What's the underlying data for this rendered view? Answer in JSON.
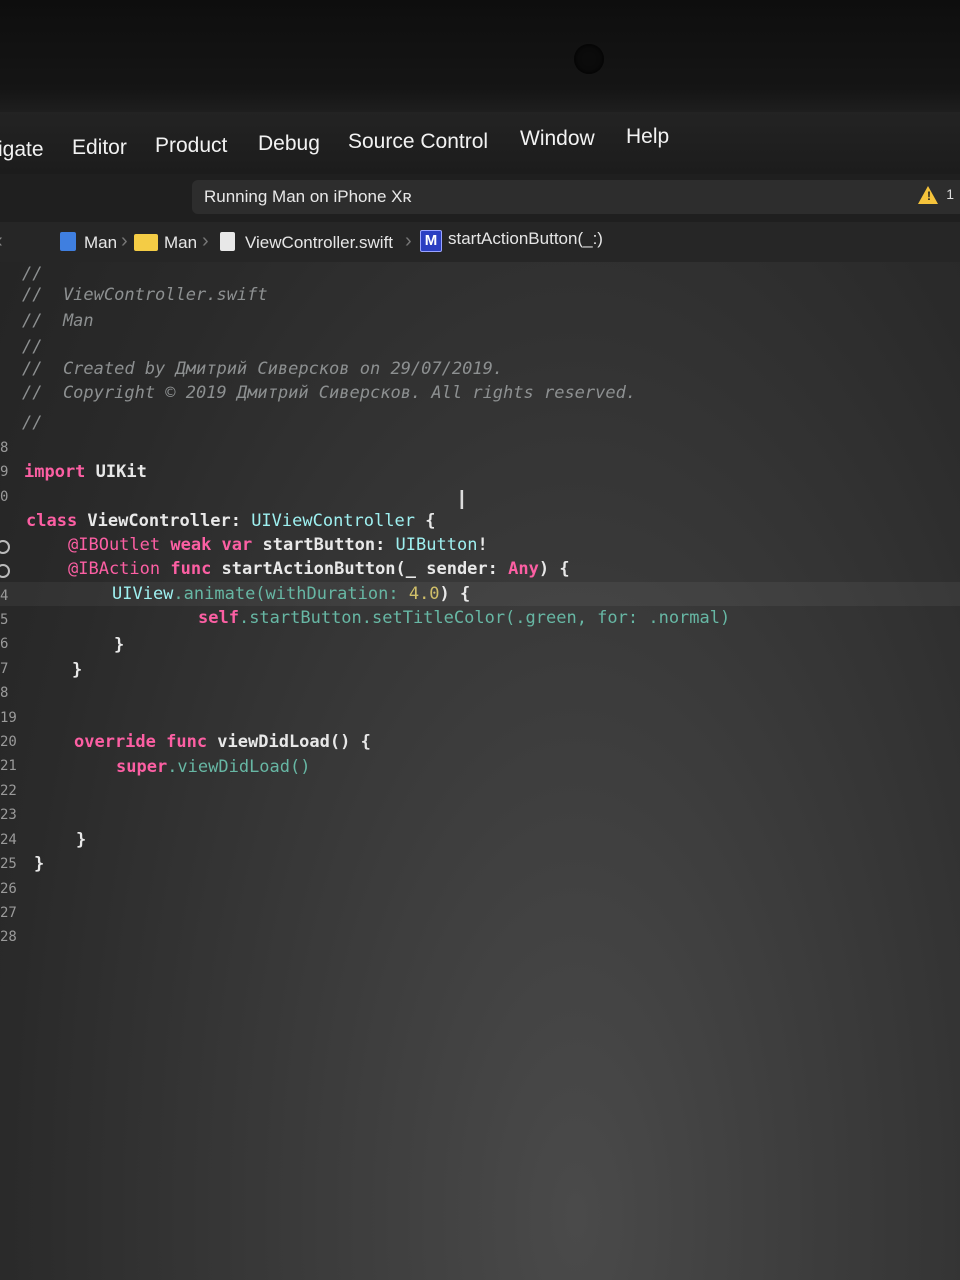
{
  "menu": {
    "items": [
      "igate",
      "Editor",
      "Product",
      "Debug",
      "Source Control",
      "Window",
      "Help"
    ]
  },
  "toolbar": {
    "activity_status": "Running Man on iPhone Xʀ",
    "warning_count": "1",
    "warning_glyph": "!"
  },
  "jumpbar": {
    "back_glyph": "‹",
    "project": "Man",
    "group": "Man",
    "file": "ViewController.swift",
    "symbol": "startActionButton(_:)",
    "symbol_badge": "M",
    "separator": "›"
  },
  "editor": {
    "line_numbers": [
      "",
      "",
      "",
      "",
      "",
      "",
      "",
      "8",
      "9",
      "0",
      "",
      "",
      "",
      "4",
      "5",
      "6",
      "7",
      "8",
      "19",
      "20",
      "21",
      "22",
      "23",
      "24",
      "25",
      "26",
      "27",
      "28"
    ],
    "comment_lines": [
      "//",
      "//  ViewController.swift",
      "//  Man",
      "//",
      "//  Created by Дмитрий Сиверсков on 29/07/2019.",
      "//  Copyright © 2019 Дмитрий Сиверсков. All rights reserved.",
      "//"
    ],
    "code": {
      "import_kw": "import",
      "import_mod": " UIKit",
      "class_kw": "class",
      "class_name": " ViewController: ",
      "superclass": "UIViewController",
      "class_open": " {",
      "outlet_attr": "@IBOutlet",
      "outlet_kw": " weak var",
      "outlet_name": " startButton: ",
      "outlet_type": "UIButton",
      "outlet_bang": "!",
      "action_attr": "@IBAction",
      "action_kw": " func",
      "action_sig": " startActionButton(_ sender: ",
      "action_type": "Any",
      "action_open": ") {",
      "animate_type": "UIView",
      "animate_call": ".animate(withDuration: ",
      "animate_num": "4.0",
      "animate_open": ") {",
      "settitle_self": "self",
      "settitle_call": ".startButton.setTitleColor(.green, for: .normal)",
      "close_inner": "}",
      "close_func": "}",
      "override_kw": "override func",
      "viewdidload": " viewDidLoad() {",
      "super_kw": "super",
      "super_call": ".viewDidLoad()",
      "close_vdl": "}",
      "close_class": "}"
    }
  }
}
